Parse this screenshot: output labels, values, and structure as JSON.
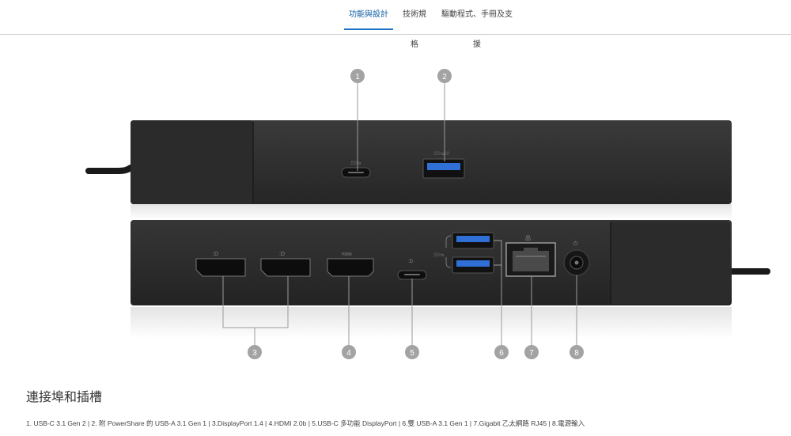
{
  "tabs": [
    {
      "label": "功能與設計",
      "active": true
    },
    {
      "label": "技術規格",
      "active": false
    },
    {
      "label": "驅動程式、手冊及支援",
      "active": false
    }
  ],
  "figure": {
    "callouts": [
      "1",
      "2",
      "3",
      "4",
      "5",
      "6",
      "7",
      "8"
    ],
    "port_labels": {
      "ss10": "SS⇆10",
      "hdmi": "HDMI",
      "ss": "SS⇆"
    },
    "colors": {
      "dock_body": "#2c2c2c",
      "port_blue": "#2f6fd6",
      "callout_gray": "#a3a3a3",
      "line_gray": "#9a9a9a"
    }
  },
  "section": {
    "heading": "連接埠和插槽",
    "caption": "1. USB-C 3.1 Gen 2 | 2. 附 PowerShare 的 USB-A 3.1 Gen 1 | 3.DisplayPort 1.4 | 4.HDMI 2.0b | 5.USB-C 多功能 DisplayPort | 6.雙 USB-A 3.1 Gen 1 | 7.Gigabit 乙太網路 RJ45 | 8.電源輸入"
  }
}
